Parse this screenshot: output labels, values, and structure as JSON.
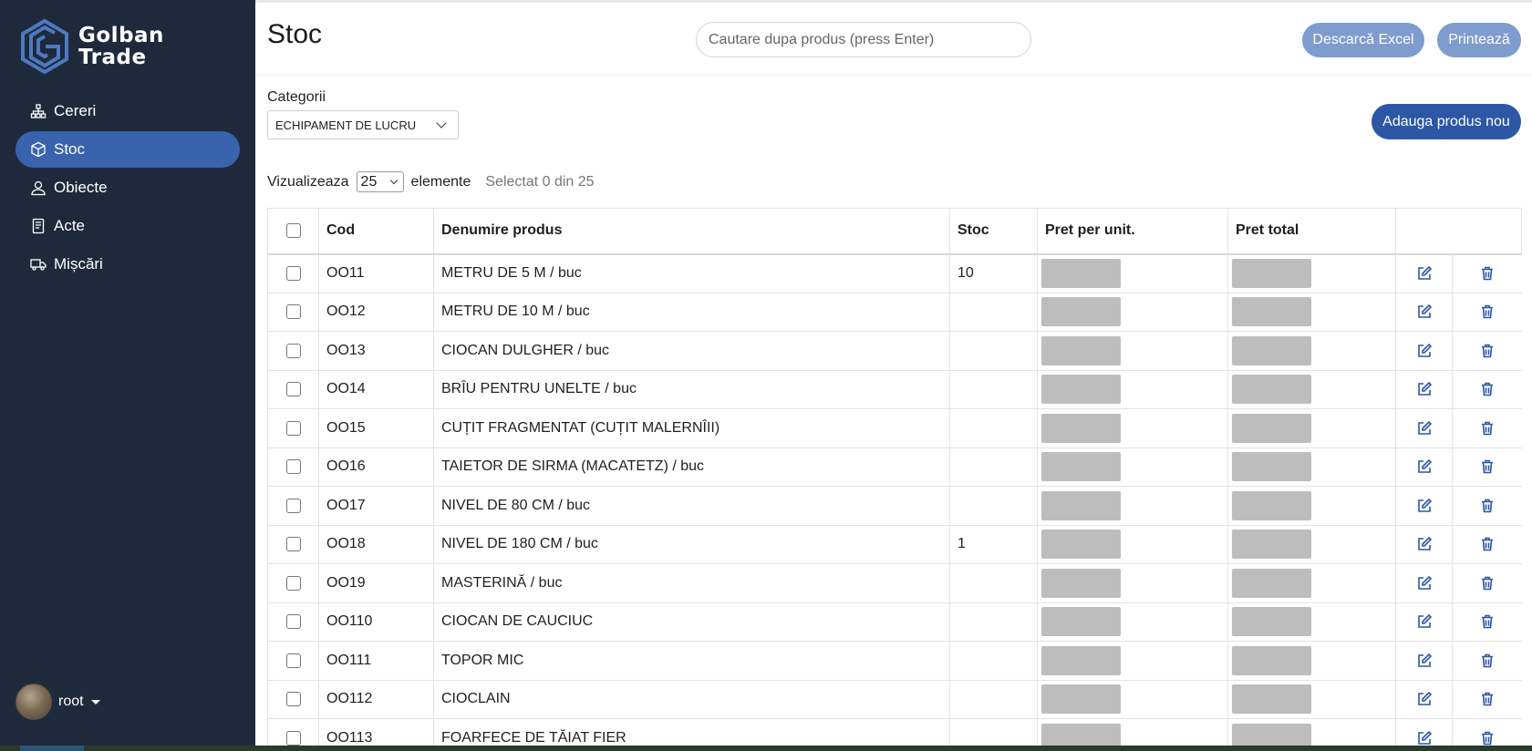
{
  "brand": {
    "line1": "Golban",
    "line2": "Trade"
  },
  "sidebar": {
    "items": [
      {
        "label": "Cereri",
        "icon": "sitemap-icon"
      },
      {
        "label": "Stoc",
        "icon": "box-icon",
        "active": true
      },
      {
        "label": "Obiecte",
        "icon": "user-icon"
      },
      {
        "label": "Acte",
        "icon": "document-icon"
      },
      {
        "label": "Mișcări",
        "icon": "truck-icon"
      }
    ]
  },
  "user": {
    "name": "root"
  },
  "header": {
    "title": "Stoc",
    "search_placeholder": "Cautare dupa produs (press Enter)",
    "excel_label": "Descarcă Excel",
    "print_label": "Printează"
  },
  "filters": {
    "category_label": "Categorii",
    "category_value": "ECHIPAMENT DE LUCRU",
    "add_label": "Adauga produs nou",
    "view_label": "Vizualizeaza",
    "page_size": "25",
    "elements_label": "elemente",
    "selected_info": "Selectat 0 din 25"
  },
  "table": {
    "headers": [
      "Cod",
      "Denumire produs",
      "Stoc",
      "Pret per unit.",
      "Pret total"
    ],
    "rows": [
      {
        "code": "OO11",
        "name": "METRU DE 5 M / buc",
        "stock": "10"
      },
      {
        "code": "OO12",
        "name": "METRU DE 10 M / buc",
        "stock": ""
      },
      {
        "code": "OO13",
        "name": "CIOCAN DULGHER / buc",
        "stock": ""
      },
      {
        "code": "OO14",
        "name": "BRÎU PENTRU UNELTE / buc",
        "stock": ""
      },
      {
        "code": "OO15",
        "name": "CUȚIT FRAGMENTAT (CUȚIT MALERNÎII)",
        "stock": ""
      },
      {
        "code": "OO16",
        "name": "TAIETOR DE SIRMA (MACATETZ) / buc",
        "stock": ""
      },
      {
        "code": "OO17",
        "name": "NIVEL DE 80 CM / buc",
        "stock": ""
      },
      {
        "code": "OO18",
        "name": "NIVEL DE 180 CM / buc",
        "stock": "1"
      },
      {
        "code": "OO19",
        "name": "MASTERINĂ / buc",
        "stock": ""
      },
      {
        "code": "OO110",
        "name": "CIOCAN DE CAUCIUC",
        "stock": ""
      },
      {
        "code": "OO111",
        "name": "TOPOR MIC",
        "stock": ""
      },
      {
        "code": "OO112",
        "name": "CIOCLAIN",
        "stock": ""
      },
      {
        "code": "OO113",
        "name": "FOARFECE DE TĂIAT FIER",
        "stock": ""
      }
    ]
  },
  "colors": {
    "sidebar_bg": "#1e2a3c",
    "active_nav": "#3a63ad",
    "primary_button": "#2b57a5",
    "light_button": "#7f9ccf",
    "icon_blue": "#2b57a5"
  }
}
